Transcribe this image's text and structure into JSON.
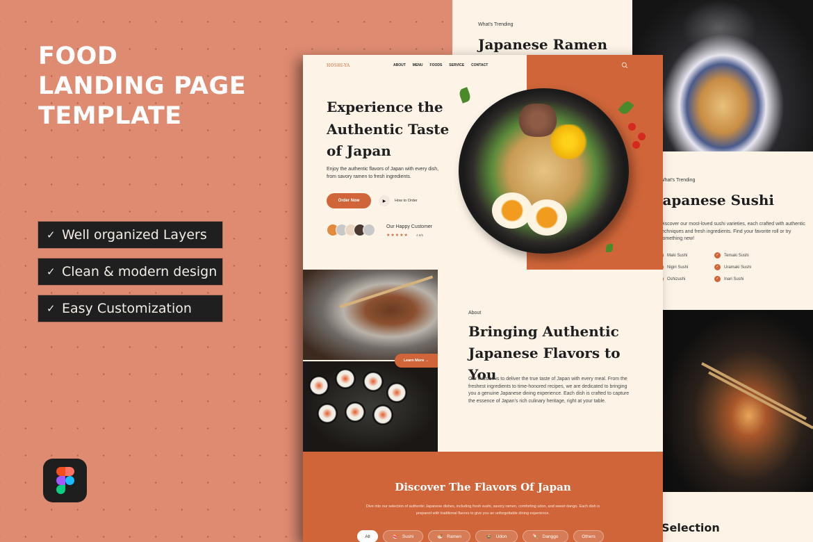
{
  "promo": {
    "title_lines": [
      "FOOD",
      "LANDING PAGE",
      "TEMPLATE"
    ],
    "features": [
      "Well organized Layers",
      "Clean & modern design",
      "Easy Customization"
    ],
    "check_glyph": "✓",
    "tool_icon": "figma-logo"
  },
  "colors": {
    "background": "#df8b72",
    "accent": "#cf6539",
    "page": "#fdf4e7",
    "feature_bg": "#1f1f1f"
  },
  "ramen_page": {
    "eyebrow": "What's Trending",
    "headline": "Japanese Ramen"
  },
  "sushi_page": {
    "eyebrow": "What's Trending",
    "headline": "Japanese Sushi",
    "description": "Discover our most-loved sushi varieties, each crafted with authentic techniques and fresh ingredients. Find your favorite roll or try something new!",
    "items": [
      "Maki Sushi",
      "Nigiri Sushi",
      "Oshizushi",
      "Temaki Sushi",
      "Uramaki Sushi",
      "Inari Sushi"
    ]
  },
  "selection_page": {
    "headline": "Selection"
  },
  "main": {
    "nav": {
      "logo": "HOSHI-YA",
      "links": [
        "ABOUT",
        "MENU",
        "FOODS",
        "SERVICE",
        "CONTACT"
      ]
    },
    "hero": {
      "title": "Experience the Authentic Taste of Japan",
      "description": "Enjoy the authentic flavors of Japan with every dish, from savory ramen to fresh ingredients.",
      "order_button": "Order Now",
      "how_to_order": "How to Order",
      "customer_label": "Our Happy Customer",
      "stars": "★★★★★",
      "rating": "4.5/5"
    },
    "about": {
      "learn_more": "Learn More →",
      "eyebrow": "About",
      "title": "Bringing Authentic Japanese Flavors to You",
      "description": "Our mission is to deliver the true taste of Japan with every meal. From the freshest ingredients to time-honored recipes, we are dedicated to bringing you a genuine Japanese dining experience. Each dish is crafted to capture the essence of Japan's rich culinary heritage, right at your table."
    },
    "discover": {
      "title": "Discover The Flavors Of Japan",
      "description": "Dive into our selection of authentic Japanese dishes, including fresh sushi, savory ramen, comforting udon, and sweet dango. Each dish is prepared with traditional flavors to give you an unforgettable dining experience.",
      "tabs": [
        {
          "label": "All",
          "icon": ""
        },
        {
          "label": "Sushi",
          "icon": "🍣"
        },
        {
          "label": "Ramen",
          "icon": "🍜"
        },
        {
          "label": "Udon",
          "icon": "🍲"
        },
        {
          "label": "Danggo",
          "icon": "🍡"
        },
        {
          "label": "Others",
          "icon": ""
        }
      ]
    }
  }
}
